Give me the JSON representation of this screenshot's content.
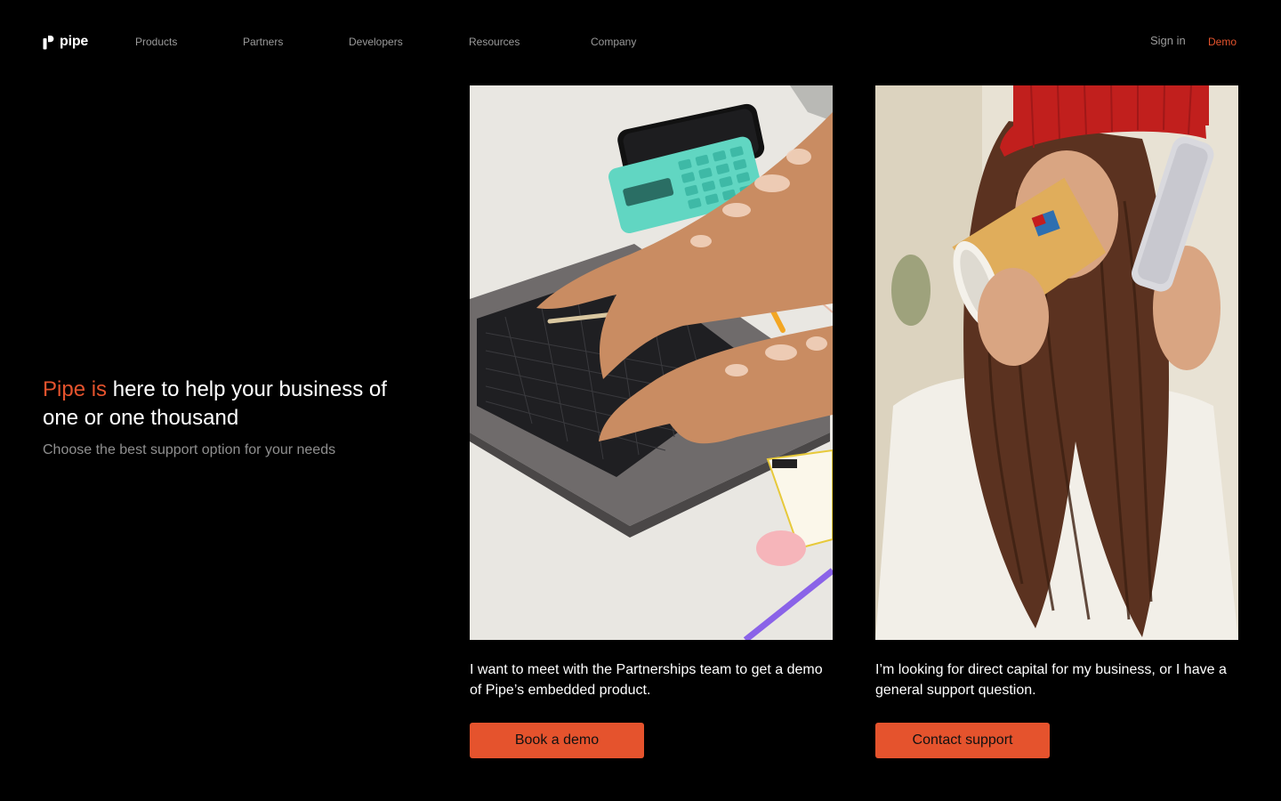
{
  "brand": {
    "name": "pipe",
    "accent_color": "#e5532d",
    "background": "#000000"
  },
  "nav": {
    "items": [
      {
        "label": "Products"
      },
      {
        "label": "Partners"
      },
      {
        "label": "Developers"
      },
      {
        "label": "Resources"
      },
      {
        "label": "Company"
      }
    ],
    "sign_in": "Sign in",
    "demo": "Demo"
  },
  "hero": {
    "title_accent": "Pipe is",
    "title_rest": " here to help your business of one or one thousand",
    "subtitle": "Choose the best support option for your needs"
  },
  "cards": [
    {
      "image": "photo-hands-typing-laptop",
      "text": "I want to meet with the Partnerships team to get a demo of Pipe’s embedded product.",
      "button": "Book a demo"
    },
    {
      "image": "photo-woman-drinking-coffee-phone",
      "text": "I’m looking for direct capital for my business, or I have a general support question.",
      "button": "Contact support"
    }
  ]
}
